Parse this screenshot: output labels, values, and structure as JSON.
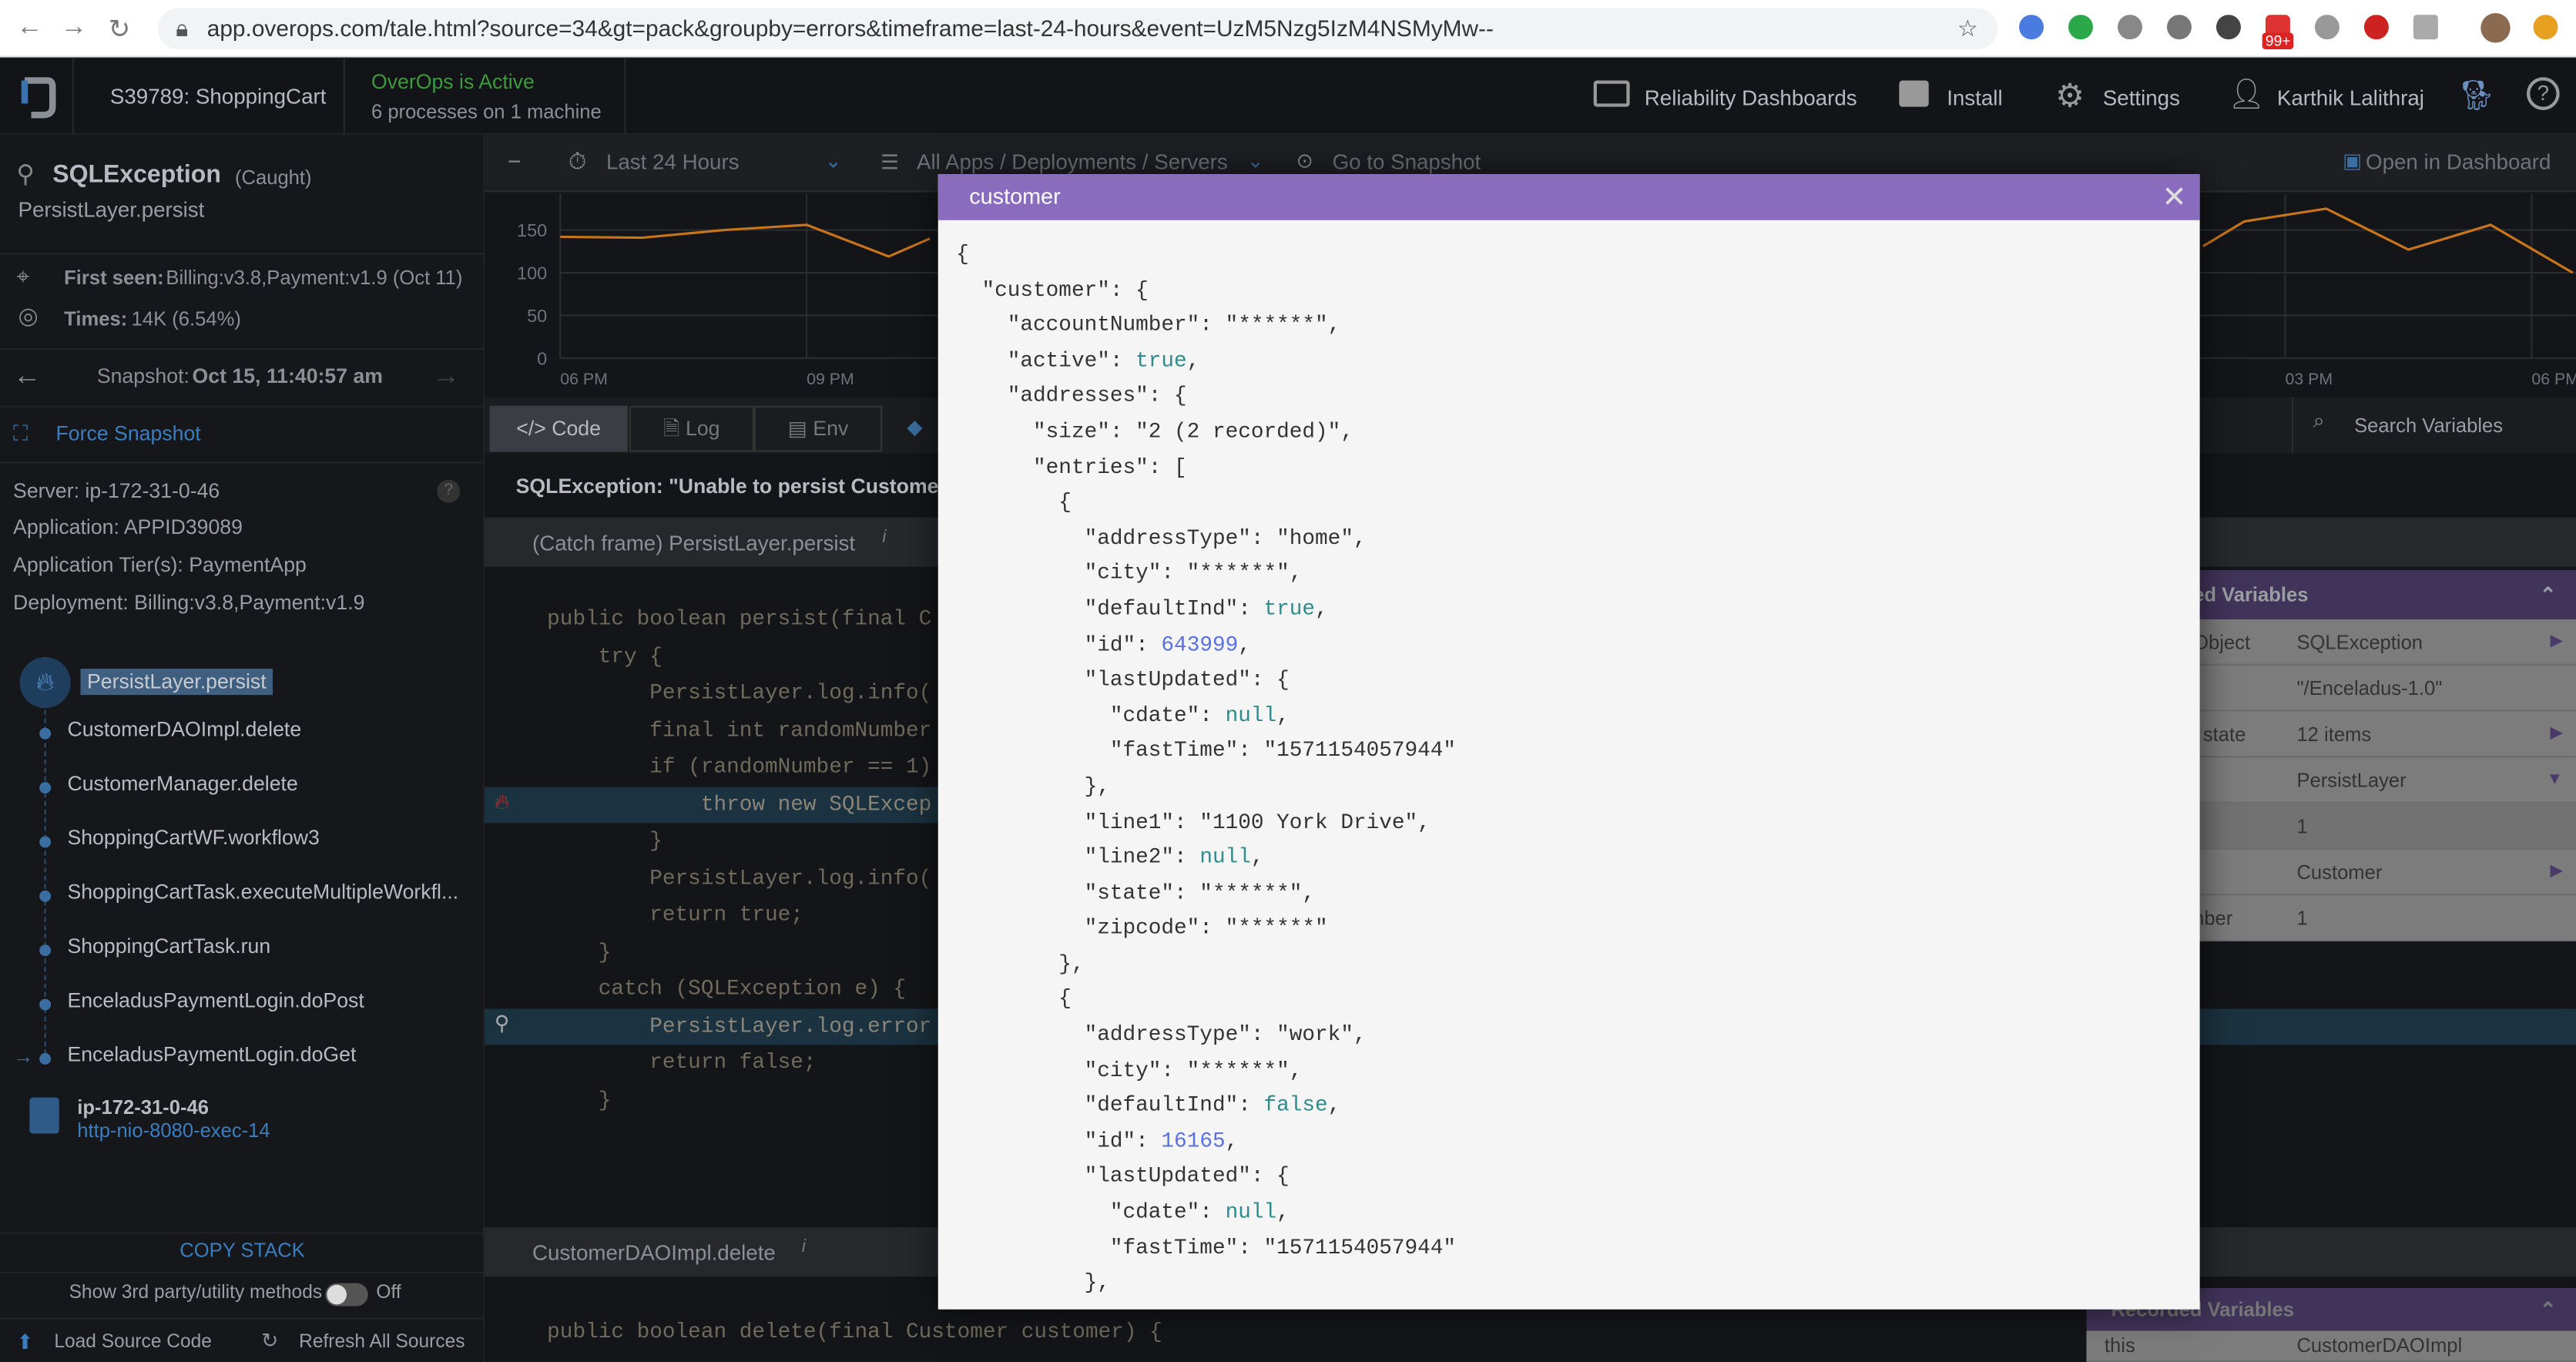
{
  "browser": {
    "url": "app.overops.com/tale.html?source=34&gt=pack&groupby=errors&timeframe=last-24-hours&event=UzM5Nzg5IzM4NSMyMw--",
    "badge": "99+"
  },
  "header": {
    "app": "S39789: ShoppingCart",
    "status": "OverOps is Active",
    "status_sub": "6 processes on 1 machine",
    "reliability": "Reliability Dashboards",
    "install": "Install",
    "settings": "Settings",
    "user": "Karthik Lalithraj",
    "status_color": "#3c9a3c"
  },
  "event": {
    "title": "SQLException",
    "caught": "(Caught)",
    "location": "PersistLayer.persist",
    "first_seen_label": "First seen:",
    "first_seen": "Billing:v3.8,Payment:v1.9 (Oct 11)",
    "times_label": "Times:",
    "times": "14K (6.54%)",
    "snapshot_label": "Snapshot:",
    "snapshot": "Oct 15, 11:40:57 am",
    "force": "Force Snapshot"
  },
  "server": {
    "server": "Server: ip-172-31-0-46",
    "app": "Application: APPID39089",
    "tier": "Application Tier(s): PaymentApp",
    "deployment": "Deployment: Billing:v3.8,Payment:v1.9"
  },
  "stack": {
    "active": "PersistLayer.persist",
    "items": [
      "CustomerDAOImpl.delete",
      "CustomerManager.delete",
      "ShoppingCartWF.workflow3",
      "ShoppingCartTask.executeMultipleWorkfl...",
      "ShoppingCartTask.run",
      "EnceladusPaymentLogin.doPost",
      "EnceladusPaymentLogin.doGet"
    ],
    "host": "ip-172-31-0-46",
    "thread": "http-nio-8080-exec-14",
    "copy": "COPY STACK",
    "third_party": "Show 3rd party/utility methods",
    "toggle": "Off",
    "load": "Load Source Code",
    "refresh": "Refresh All Sources"
  },
  "toolbar": {
    "timeframe": "Last 24 Hours",
    "apps": "All Apps / Deployments / Servers",
    "goto": "Go to Snapshot",
    "open": "Open in Dashboard",
    "search": "Search Variables"
  },
  "tabs": [
    {
      "label": "</> Code"
    },
    {
      "label": "Log"
    },
    {
      "label": "Env"
    }
  ],
  "chart_data": {
    "type": "line",
    "color": "#c8741c",
    "ylim": [
      0,
      150
    ],
    "yticks": [
      "150",
      "100",
      "50",
      "0"
    ],
    "xticks": [
      "06 PM",
      "09 PM",
      "03 PM",
      "06 PM"
    ],
    "grid": true,
    "series": [
      {
        "x": [
          "18:00",
          "19:00",
          "20:00",
          "21:00",
          "22:00",
          "22:30"
        ],
        "values": [
          142,
          141,
          150,
          156,
          119,
          140
        ]
      },
      {
        "x": [
          "14:00",
          "14:30",
          "15:30",
          "16:30",
          "17:30",
          "18:30"
        ],
        "values": [
          131,
          160,
          175,
          127,
          156,
          100
        ]
      }
    ]
  },
  "code": {
    "error": "SQLException: \"Unable to persist Customer: C",
    "frame1": "(Catch frame) PersistLayer.persist",
    "frame2": "CustomerDAOImpl.delete",
    "lines": [
      "public boolean persist(final C",
      "    try {",
      "        PersistLayer.log.info(",
      "        final int randomNumber",
      "        if (randomNumber == 1)",
      "            throw new SQLExcep",
      "        }",
      "        PersistLayer.log.info(",
      "        return true;",
      "    }",
      "    catch (SQLException e) {",
      "        PersistLayer.log.error",
      "        return false;",
      "    }"
    ],
    "line2": "public boolean delete(final Customer customer) {"
  },
  "variables": {
    "title": "ed Variables",
    "title2": "Recorded Variables",
    "rows": [
      {
        "k": "Object",
        "v": "SQLException",
        "arrow": "right"
      },
      {
        "k": "",
        "v": "\"/Enceladus-1.0\""
      },
      {
        "k": "l state",
        "v": "12 items",
        "arrow": "right"
      },
      {
        "k": "",
        "v": "PersistLayer",
        "arrow": "down"
      },
      {
        "k": "",
        "v": "1"
      },
      {
        "k": "",
        "v": "Customer",
        "arrow": "right"
      },
      {
        "k": "nber",
        "v": "1"
      }
    ],
    "this_k": "this",
    "this_v": "CustomerDAOImpl"
  },
  "modal": {
    "title": "customer",
    "lines": [
      [
        [
          "{",
          ""
        ]
      ],
      [
        [
          "  \"customer\": {",
          ""
        ]
      ],
      [
        [
          "    \"accountNumber\": \"******\",",
          ""
        ]
      ],
      [
        [
          "    \"active\": ",
          ""
        ],
        [
          "true",
          "b"
        ],
        [
          ",",
          ""
        ]
      ],
      [
        [
          "    \"addresses\": {",
          ""
        ]
      ],
      [
        [
          "      \"size\": \"2 (2 recorded)\",",
          ""
        ]
      ],
      [
        [
          "      \"entries\": [",
          ""
        ]
      ],
      [
        [
          "        {",
          ""
        ]
      ],
      [
        [
          "          \"addressType\": \"home\",",
          ""
        ]
      ],
      [
        [
          "          \"city\": \"******\",",
          ""
        ]
      ],
      [
        [
          "          \"defaultInd\": ",
          ""
        ],
        [
          "true",
          "b"
        ],
        [
          ",",
          ""
        ]
      ],
      [
        [
          "          \"id\": ",
          ""
        ],
        [
          "643999",
          "n"
        ],
        [
          ",",
          ""
        ]
      ],
      [
        [
          "          \"lastUpdated\": {",
          ""
        ]
      ],
      [
        [
          "            \"cdate\": ",
          ""
        ],
        [
          "null",
          "nl"
        ],
        [
          ",",
          ""
        ]
      ],
      [
        [
          "            \"fastTime\": \"1571154057944\"",
          ""
        ]
      ],
      [
        [
          "          },",
          ""
        ]
      ],
      [
        [
          "          \"line1\": \"1100 York Drive\",",
          ""
        ]
      ],
      [
        [
          "          \"line2\": ",
          ""
        ],
        [
          "null",
          "nl"
        ],
        [
          ",",
          ""
        ]
      ],
      [
        [
          "          \"state\": \"******\",",
          ""
        ]
      ],
      [
        [
          "          \"zipcode\": \"******\"",
          ""
        ]
      ],
      [
        [
          "        },",
          ""
        ]
      ],
      [
        [
          "        {",
          ""
        ]
      ],
      [
        [
          "          \"addressType\": \"work\",",
          ""
        ]
      ],
      [
        [
          "          \"city\": \"******\",",
          ""
        ]
      ],
      [
        [
          "          \"defaultInd\": ",
          ""
        ],
        [
          "false",
          "b"
        ],
        [
          ",",
          ""
        ]
      ],
      [
        [
          "          \"id\": ",
          ""
        ],
        [
          "16165",
          "n"
        ],
        [
          ",",
          ""
        ]
      ],
      [
        [
          "          \"lastUpdated\": {",
          ""
        ]
      ],
      [
        [
          "            \"cdate\": ",
          ""
        ],
        [
          "null",
          "nl"
        ],
        [
          ",",
          ""
        ]
      ],
      [
        [
          "            \"fastTime\": \"1571154057944\"",
          ""
        ]
      ],
      [
        [
          "          },",
          ""
        ]
      ]
    ]
  }
}
